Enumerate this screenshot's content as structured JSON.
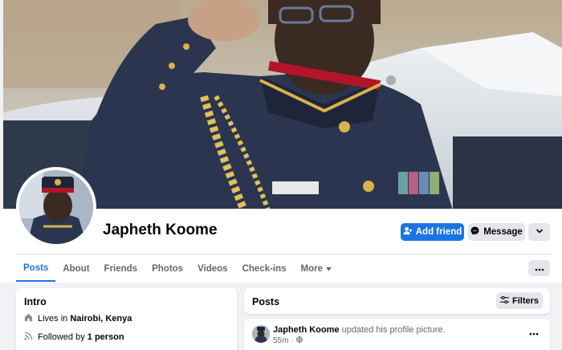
{
  "profile": {
    "name": "Japheth Koome",
    "cover_alt": "cover-photo",
    "avatar_alt": "profile-picture"
  },
  "actions": {
    "add_friend": "Add friend",
    "message": "Message",
    "more_icon": "chevron-down-icon"
  },
  "tabs": [
    {
      "label": "Posts",
      "active": true
    },
    {
      "label": "About"
    },
    {
      "label": "Friends"
    },
    {
      "label": "Photos"
    },
    {
      "label": "Videos"
    },
    {
      "label": "Check-ins"
    },
    {
      "label": "More"
    }
  ],
  "intro": {
    "title": "Intro",
    "lives_prefix": "Lives in",
    "lives_place": "Nairobi, Kenya",
    "followed_prefix": "Followed by",
    "followed_count": "1 person"
  },
  "posts": {
    "title": "Posts",
    "filters_label": "Filters",
    "items": [
      {
        "author": "Japheth Koome",
        "action": "updated his profile picture.",
        "time": "55m"
      }
    ]
  },
  "colors": {
    "accent": "#1b74e4",
    "page_bg": "#f0f2f5",
    "secondary_button": "#e4e6eb",
    "muted_text": "#65676b"
  }
}
